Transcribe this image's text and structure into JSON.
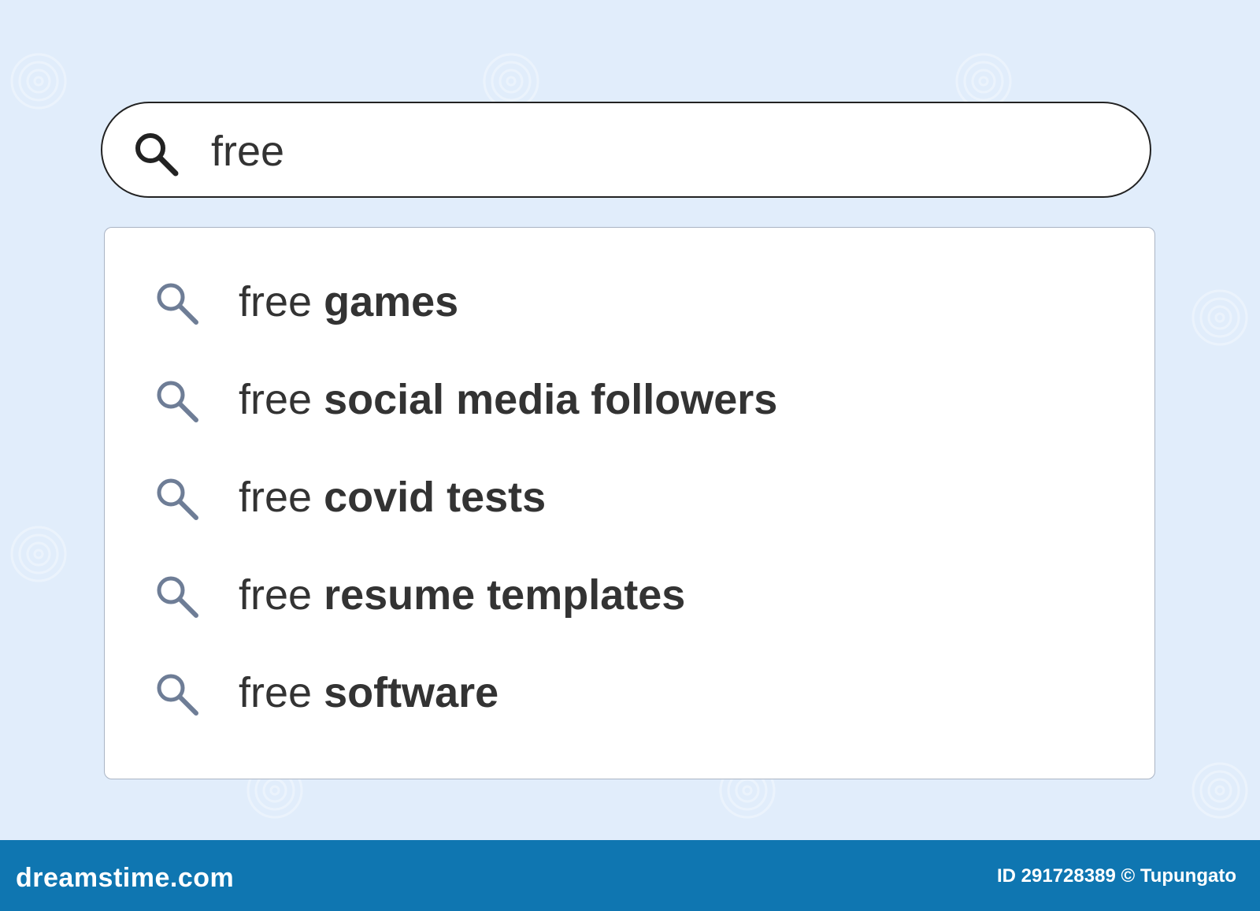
{
  "search": {
    "query": "free",
    "icon": "search-icon"
  },
  "suggestions": [
    {
      "prefix": "free",
      "completion": "games",
      "icon": "search-icon"
    },
    {
      "prefix": "free",
      "completion": "social media followers",
      "icon": "search-icon"
    },
    {
      "prefix": "free",
      "completion": "covid tests",
      "icon": "search-icon"
    },
    {
      "prefix": "free",
      "completion": "resume templates",
      "icon": "search-icon"
    },
    {
      "prefix": "free",
      "completion": "software",
      "icon": "search-icon"
    }
  ],
  "footer": {
    "brand": "dreamstime.com",
    "credit": "ID 291728389 © Tupungato"
  },
  "colors": {
    "background": "#e1edfb",
    "footer": "#0f76b1",
    "text": "#333333",
    "suggestion_icon": "#6e7d96"
  }
}
